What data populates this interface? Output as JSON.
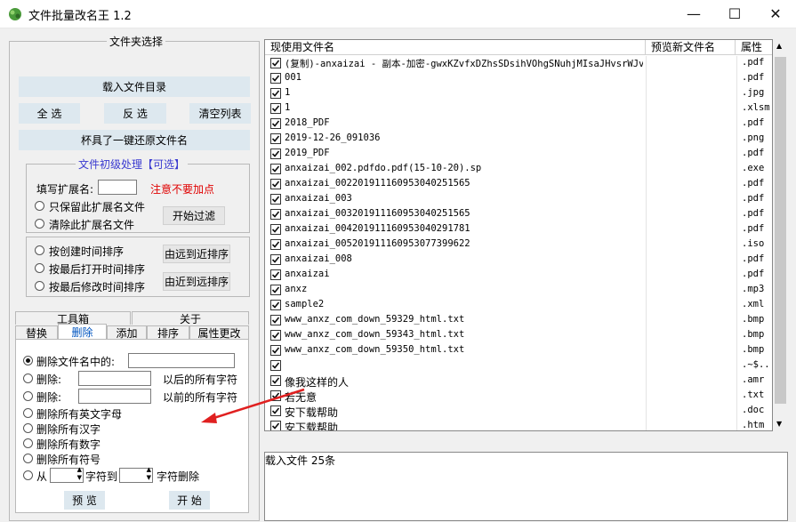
{
  "window": {
    "title": "文件批量改名王  1.2",
    "minimize_glyph": "—",
    "maximize_glyph": "☐",
    "close_glyph": "✕"
  },
  "folder_group": {
    "title": "文件夹选择",
    "load_dir_button": "载入文件目录",
    "select_all_button": "全 选",
    "invert_button": "反 选",
    "clear_list_button": "清空列表",
    "restore_button": "杯具了一键还原文件名"
  },
  "initial_group": {
    "title": "文件初级处理【可选】",
    "ext_label": "填写扩展名:",
    "ext_value": "",
    "ext_hint": "注意不要加点",
    "keep_ext_label": "只保留此扩展名文件",
    "clear_ext_label": "清除此扩展名文件",
    "start_filter_button": "开始过滤"
  },
  "sort_group": {
    "by_create_label": "按创建时间排序",
    "by_open_label": "按最后打开时间排序",
    "by_modify_label": "按最后修改时间排序",
    "far_to_near_button": "由远到近排序",
    "near_to_far_button": "由近到远排序"
  },
  "tabs": {
    "top": [
      "工具箱",
      "关于"
    ],
    "bottom": [
      "替换",
      "删除",
      "添加",
      "排序",
      "属性更改"
    ],
    "active": "删除"
  },
  "delete_panel": {
    "opt1_label": "删除文件名中的:",
    "opt2_label": "删除:",
    "opt2_suffix": "以后的所有字符",
    "opt3_label": "删除:",
    "opt3_suffix": "以前的所有字符",
    "opt4_label": "删除所有英文字母",
    "opt5_label": "删除所有汉字",
    "opt6_label": "删除所有数字",
    "opt7_label": "删除所有符号",
    "opt8_from": "从",
    "opt8_to": "字符到",
    "opt8_suffix": "字符删除",
    "preview_button": "预 览",
    "start_button": "开 始"
  },
  "list": {
    "headers": {
      "current": "现使用文件名",
      "preview": "预览新文件名",
      "attr": "属性"
    },
    "rows": [
      {
        "name": "(复制)-anxaizai - 副本-加密-gwxKZvfxDZhsSDsihVOhgSNuhjMIsaJHvsrWJv",
        "ext": ".pdf"
      },
      {
        "name": "001",
        "ext": ".pdf"
      },
      {
        "name": "1",
        "ext": ".jpg"
      },
      {
        "name": "1",
        "ext": ".xlsm"
      },
      {
        "name": "2018_PDF",
        "ext": ".pdf"
      },
      {
        "name": "2019-12-26_091036",
        "ext": ".png"
      },
      {
        "name": "2019_PDF",
        "ext": ".pdf"
      },
      {
        "name": "anxaizai_002.pdfdo.pdf(15-10-20).sp",
        "ext": ".exe"
      },
      {
        "name": "anxaizai_002201911160953040251565",
        "ext": ".pdf"
      },
      {
        "name": "anxaizai_003",
        "ext": ".pdf"
      },
      {
        "name": "anxaizai_003201911160953040251565",
        "ext": ".pdf"
      },
      {
        "name": "anxaizai_004201911160953040291781",
        "ext": ".pdf"
      },
      {
        "name": "anxaizai_005201911160953077399622",
        "ext": ".iso"
      },
      {
        "name": "anxaizai_008",
        "ext": ".pdf"
      },
      {
        "name": "anxaizai",
        "ext": ".pdf"
      },
      {
        "name": "anxz",
        "ext": ".mp3"
      },
      {
        "name": "sample2",
        "ext": ".xml"
      },
      {
        "name": "www_anxz_com_down_59329_html.txt",
        "ext": ".bmp"
      },
      {
        "name": "www_anxz_com_down_59343_html.txt",
        "ext": ".bmp"
      },
      {
        "name": "www_anxz_com_down_59350_html.txt",
        "ext": ".bmp"
      },
      {
        "name": "",
        "ext": ".~$..."
      },
      {
        "name": "像我这样的人",
        "ext": ".amr"
      },
      {
        "name": "若无意",
        "ext": ".txt"
      },
      {
        "name": "安下载帮助",
        "ext": ".doc"
      },
      {
        "name": "安下载帮助",
        "ext": ".htm"
      }
    ]
  },
  "status": {
    "text": "载入文件  25条"
  },
  "colors": {
    "arrow": "#e02020",
    "hint": "#e00000",
    "group_title": "#3a3ad0",
    "active_tab": "#0055c0"
  }
}
